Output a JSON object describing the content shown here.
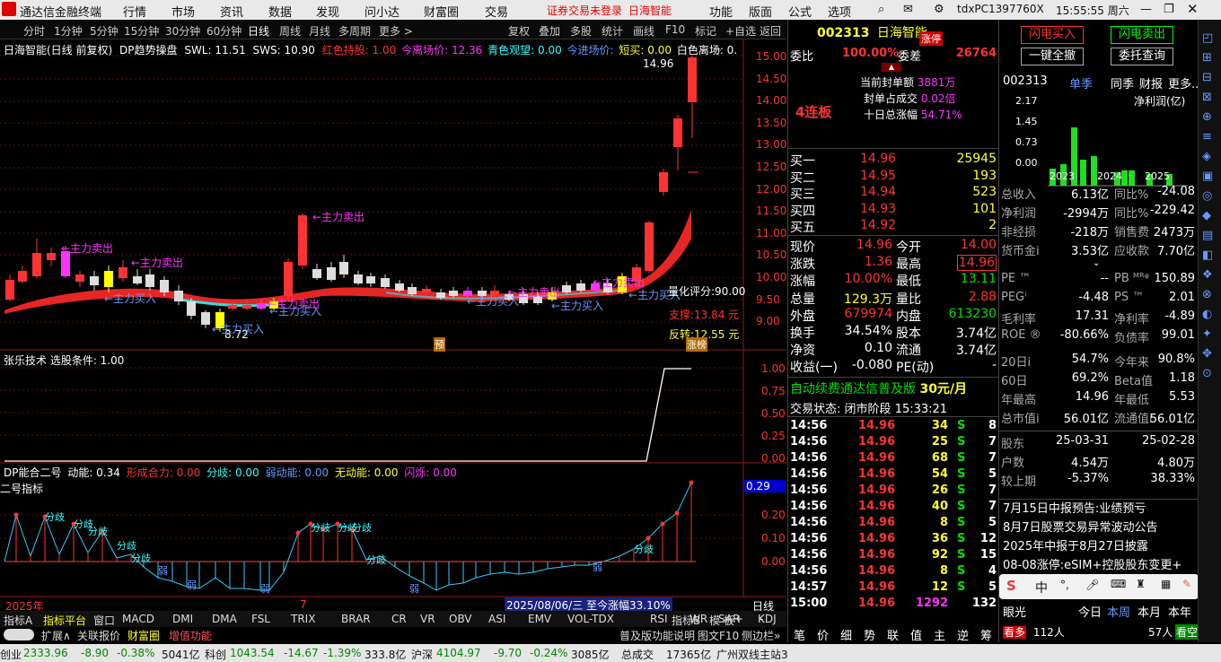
{
  "app": {
    "title": "通达信金融终端",
    "menu": [
      "行情",
      "市场",
      "资讯",
      "数据",
      "发现",
      "问小达",
      "财富圈",
      "交易"
    ],
    "warning": "证券交易未登录",
    "stock_title": "日海智能",
    "menu_right": [
      "功能",
      "版面",
      "公式",
      "选项"
    ],
    "user": "tdxPC1397760X",
    "clock": "15:55:55 周六"
  },
  "toolbar": {
    "periods": [
      "分时",
      "1分钟",
      "5分钟",
      "15分钟",
      "30分钟",
      "60分钟",
      "日线",
      "周线",
      "月线",
      "多周期",
      "更多 >"
    ],
    "actions": [
      "复权",
      "叠加",
      "多股",
      "统计",
      "画线",
      "F10",
      "标记",
      "+自选",
      "返回"
    ]
  },
  "chart": {
    "title": "日海智能(日线 前复权)",
    "indicator": "DP趋势操盘",
    "swl": "SWL: 11.51",
    "sws": "SWS: 10.90",
    "hold": "红色持股: 1.00",
    "exit": "今离场价: 12.36",
    "watch": "青色观望: 0.00",
    "entry": "今进场价:",
    "short": "短买: 0.00",
    "white_exit": "白色离场: 0.",
    "high_label": "14.96",
    "low_label": "8.72",
    "prices": [
      "15.00",
      "14.50",
      "14.00",
      "13.50",
      "13.00",
      "12.50",
      "12.00",
      "11.50",
      "11.00",
      "10.50",
      "10.00",
      "9.50",
      "9.00"
    ],
    "rating": "量化评分:90.00",
    "support": "支撑:13.84 元",
    "reversal": "反转:12.55 元",
    "yu": "预",
    "zhangting": "涨榜",
    "signals": {
      "sell": "←主力卖出",
      "buy": "←主力买入"
    }
  },
  "panel2": {
    "title": "张乐技术 选股条件: 1.00",
    "levels": [
      "1.00",
      "0.75",
      "0.50",
      "0.25",
      "0.00"
    ]
  },
  "panel3": {
    "title": "DP能合二号",
    "power": "动能: 0.34",
    "form": "形成合力: 0.00",
    "split": "分歧: 0.00",
    "weak": "弱动能: 0.00",
    "none": "无动能: 0.00",
    "flash": "闪烁: 0.00",
    "ind": "二号指标",
    "value": "0.29",
    "levels": [
      "0.20",
      "0.10",
      "0.00"
    ],
    "labels": {
      "split": "分歧",
      "weak": "弱"
    }
  },
  "xaxis": {
    "year": "2025年",
    "mid": "7",
    "date": "2025/08/06/三 至今涨幅33.10%",
    "period": "日线"
  },
  "tabs": [
    "指标A",
    "指标平台",
    "窗口",
    "MACD",
    "DMI",
    "DMA",
    "FSL",
    "TRIX",
    "BRAR",
    "CR",
    "VR",
    "OBV",
    "ASI",
    "EMV",
    "VOL-TDX",
    "RSI",
    "WR",
    "SAR",
    "KDJ",
    "CCI",
    "ROC",
    "指标B",
    "模 板",
    "+",
    "-"
  ],
  "bottom2": [
    "扩展∧",
    "关联报价",
    "财富圈",
    "增值功能",
    "普及版功能说明",
    "图文F10",
    "侧边栏»"
  ],
  "quote": {
    "code": "002313",
    "name": "日海智能",
    "badge": "涨停",
    "webi_label": "委比",
    "webi": "100.00%",
    "weicha_label": "委差",
    "weicha": "26764",
    "lianban": "4连板",
    "seal_amt_label": "当前封单额",
    "seal_amt": "3881万",
    "seal_ratio_label": "封单占成交",
    "seal_ratio": "0.02倍",
    "ten_day_label": "十日总涨幅",
    "ten_day": "54.71%",
    "bids": [
      {
        "l": "买一",
        "p": "14.96",
        "v": "25945"
      },
      {
        "l": "买二",
        "p": "14.95",
        "v": "193"
      },
      {
        "l": "买三",
        "p": "14.94",
        "v": "523"
      },
      {
        "l": "买四",
        "p": "14.93",
        "v": "101"
      },
      {
        "l": "买五",
        "p": "14.92",
        "v": "2"
      }
    ],
    "stats": [
      [
        "现价",
        "14.96",
        "今开",
        "14.00"
      ],
      [
        "涨跌",
        "1.36",
        "最高",
        "14.96"
      ],
      [
        "涨幅",
        "10.00%",
        "最低",
        "13.11"
      ],
      [
        "总量",
        "129.3万",
        "量比",
        "2.88"
      ],
      [
        "外盘",
        "679974",
        "内盘",
        "613230"
      ],
      [
        "换手",
        "34.54%",
        "股本",
        "3.74亿"
      ],
      [
        "净资",
        "0.10",
        "流通",
        "3.74亿"
      ],
      [
        "收益(一)",
        "-0.080",
        "PE(动)",
        "-"
      ]
    ],
    "ad": "自动续费通达信普及版",
    "price": "30元/月",
    "state_label": "交易状态:",
    "state": "闭市阶段",
    "state_time": "15:33:21",
    "ticks": [
      [
        "14:56",
        "14.96",
        "34",
        "S",
        "8"
      ],
      [
        "14:56",
        "14.96",
        "25",
        "S",
        "7"
      ],
      [
        "14:56",
        "14.96",
        "68",
        "S",
        "7"
      ],
      [
        "14:56",
        "14.96",
        "54",
        "S",
        "5"
      ],
      [
        "14:56",
        "14.96",
        "26",
        "S",
        "7"
      ],
      [
        "14:56",
        "14.96",
        "40",
        "S",
        "7"
      ],
      [
        "14:56",
        "14.96",
        "8",
        "S",
        "5"
      ],
      [
        "14:56",
        "14.96",
        "36",
        "S",
        "12"
      ],
      [
        "14:56",
        "14.96",
        "92",
        "S",
        "15"
      ],
      [
        "14:56",
        "14.96",
        "8",
        "S",
        "4"
      ],
      [
        "14:57",
        "14.96",
        "12",
        "S",
        "5"
      ],
      [
        "15:00",
        "14.96",
        "1292",
        "",
        "132"
      ]
    ],
    "tabs": [
      "笔",
      "价",
      "细",
      "势",
      "联",
      "值",
      "主",
      "逆",
      "筹"
    ]
  },
  "fin": {
    "btn_buy": "闪电买入",
    "btn_sell": "闪电卖出",
    "btn_all": "一键全撤",
    "btn_cancel": "委托查询",
    "code": "002313",
    "tabs": [
      "单季",
      "同季",
      "财报",
      "更多..."
    ],
    "metric": "净利润(亿)",
    "yaxis": [
      "2.17",
      "1.45",
      "0.73",
      "0.00"
    ],
    "years": [
      "2023",
      "2024",
      "2025"
    ],
    "rows": [
      [
        "总收入",
        "6.13亿",
        "同比%",
        "-24.08"
      ],
      [
        "净利润",
        "-2994万",
        "同比%",
        "-229.42"
      ],
      [
        "非经损",
        "-218万",
        "销售费",
        "2473万"
      ],
      [
        "货币金ⅰ",
        "3.53亿",
        "应收款",
        "7.70亿"
      ]
    ],
    "rows2": [
      [
        "PE ™",
        "--",
        "PB ᴹᴿᵠ",
        "150.89"
      ],
      [
        "PEGⁱ",
        "-4.48",
        "PS ™",
        "2.01"
      ],
      [
        "毛利率",
        "17.31",
        "净利率",
        "-4.89"
      ],
      [
        "ROE ®",
        "-80.66%",
        "负债率",
        "99.01"
      ]
    ],
    "rows3": [
      [
        "20日ⅰ",
        "54.7%",
        "今年来",
        "90.8%"
      ],
      [
        "60日",
        "69.2%",
        "Beta值",
        "1.18"
      ],
      [
        "年最高",
        "14.96",
        "年最低",
        "5.53"
      ],
      [
        "总市值ⅰ",
        "56.01亿",
        "流通值ⅰ",
        "56.01亿"
      ]
    ],
    "holders": [
      [
        "股东",
        "25-03-31",
        "25-02-28"
      ],
      [
        "户数",
        "4.54万",
        "4.80万"
      ],
      [
        "较上期",
        "-5.37%",
        "38.33%"
      ]
    ],
    "news": [
      "7月15日中报预告:业绩预亏",
      "8月7日股票交易异常波动公告",
      "2025年中报于8月27日披露",
      "08-08涨停:eSIM+控股股东变更+"
    ],
    "eye_label": "眼光",
    "eye_tabs": [
      "今日",
      "本周",
      "本月",
      "本年"
    ],
    "eye_rise": "看多",
    "eye_rise_n": "112人",
    "eye_fall_n": "57人",
    "eye_fall": "看空"
  },
  "status": {
    "chuang": "创业",
    "chuang_v": "2333.96",
    "chuang_c": "-8.90",
    "chuang_p": "-0.38%",
    "chuang_a": "5041亿",
    "ke": "科创",
    "ke_v": "1043.54",
    "ke_c": "-14.67",
    "ke_p": "-1.39%",
    "ke_a": "333.8亿",
    "hs": "沪深",
    "hs_v": "4104.97",
    "hs_c": "-9.70",
    "hs_p": "-0.24%",
    "hs_a": "3085亿",
    "tot": "总成交",
    "tot_v": "17365亿",
    "server": "广州双线主站3"
  }
}
